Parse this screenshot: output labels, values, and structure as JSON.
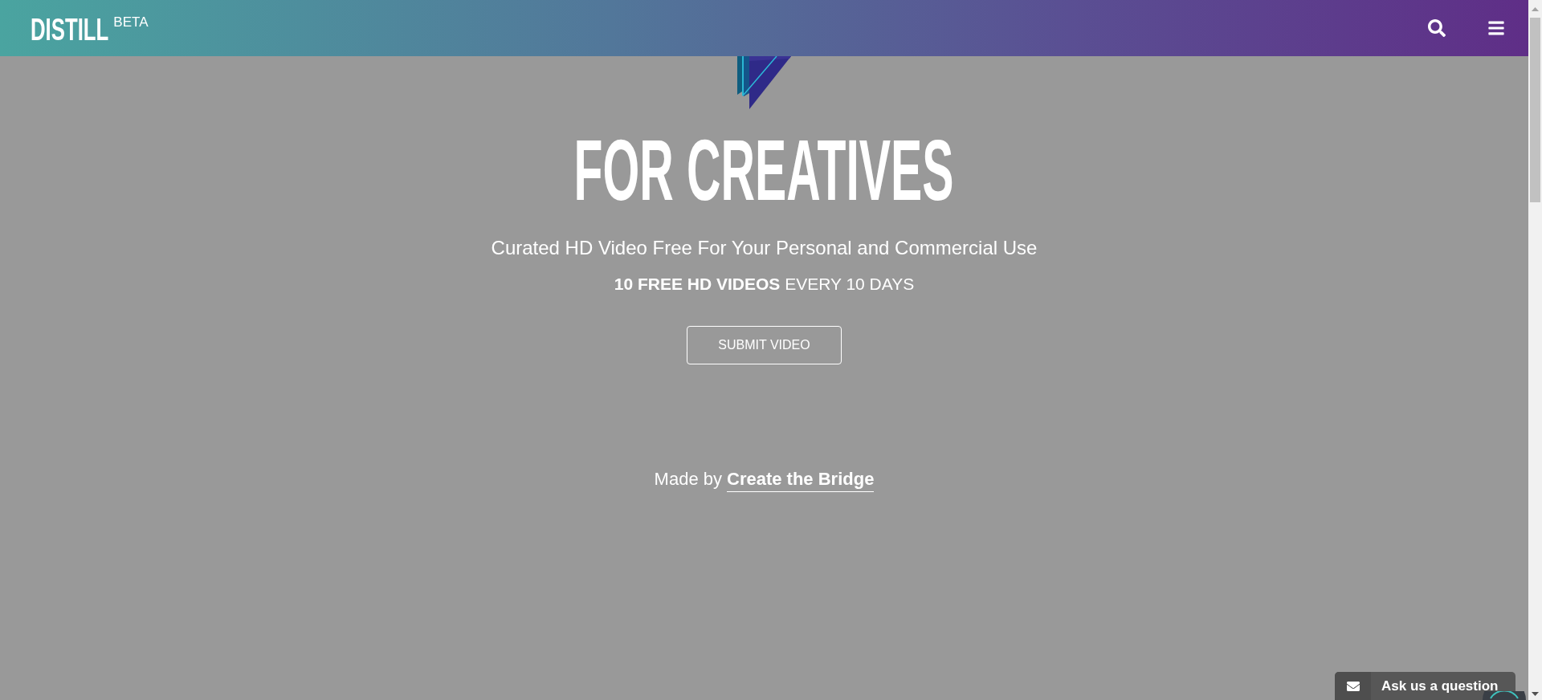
{
  "header": {
    "logo": "DISTILL",
    "badge": "BETA"
  },
  "hero": {
    "title": "FOR CREATIVES",
    "subtitle": "Curated HD Video Free For Your Personal and Commercial Use",
    "tagline": "**10 FREE HD VIDEOS** EVERY 10 DAYS",
    "button": "SUBMIT VIDEO"
  },
  "credit": {
    "prefix": "Made by",
    "link": "Create the Bridge"
  },
  "chat_widget": {
    "label": "Ask us a question"
  }
}
